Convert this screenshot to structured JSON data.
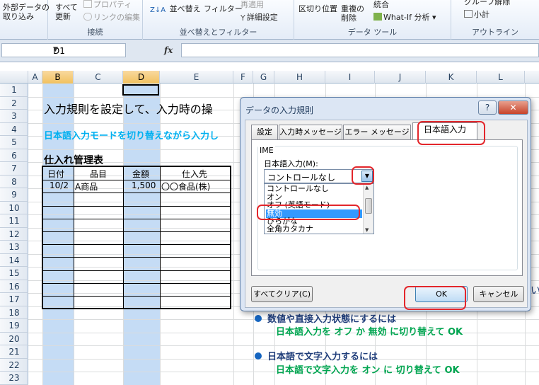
{
  "ribbon": {
    "external_data": "外部データの\n取り込み",
    "refresh_all": "すべて\n更新",
    "properties": "プロパティ",
    "edit_links": "リンクの編集",
    "connections_group": "接続",
    "sort": "並べ替え",
    "filter": "フィルター",
    "reapply": "再適用",
    "advanced": "詳細設定",
    "sort_filter_group": "並べ替えとフィルター",
    "text_to_columns": "区切り位置",
    "remove_duplicates": "重複の\n削除",
    "consolidate": "統合",
    "what_if": "What-If 分析",
    "data_tools_group": "データ ツール",
    "group": "グループ解除",
    "subtotal": "小計",
    "outline_group": "アウトライン"
  },
  "formula_bar": {
    "name_box": "D1",
    "fx": "fx",
    "formula": ""
  },
  "columns": [
    "A",
    "B",
    "C",
    "D",
    "E",
    "F",
    "G",
    "H",
    "I",
    "J",
    "K",
    "L"
  ],
  "rows": [
    "1",
    "2",
    "3",
    "4",
    "5",
    "6",
    "7",
    "8",
    "9",
    "10",
    "11",
    "12",
    "13",
    "14",
    "15",
    "16",
    "17",
    "18",
    "19",
    "20",
    "21",
    "22",
    "23"
  ],
  "sheet": {
    "title": "入力規則を設定して、入力時の操",
    "subtitle": "日本語入力モードを切り替えながら入力し",
    "table_caption": "仕入れ管理表",
    "headers": [
      "日付",
      "品目",
      "金額",
      "仕入先"
    ],
    "row1": [
      "10/2",
      "A商品",
      "1,500",
      "〇〇食品(株)"
    ]
  },
  "notes": {
    "n1_head": "数値や直接入力状態にするには",
    "n1_sub": "日本語入力を オフ か 無効 に切り替えて OK",
    "n2_head": "日本語で文字入力するには",
    "n2_sub": "日本語で文字入力を オン に 切り替えて OK",
    "side_char": "い"
  },
  "dialog": {
    "title": "データの入力規則",
    "help": "?",
    "close": "✕",
    "tabs": [
      "設定",
      "入力時メッセージ",
      "エラー メッセージ",
      "日本語入力"
    ],
    "group_label": "IME",
    "mode_label": "日本語入力(M):",
    "combo_value": "コントロールなし",
    "options": [
      "コントロールなし",
      "オン",
      "オフ (英語モード)",
      "無効",
      "ひらがな",
      "全角カタカナ"
    ],
    "selected_option": "無効",
    "clear_all": "すべてクリア(C)",
    "ok": "OK",
    "cancel": "キャンセル"
  },
  "colors": {
    "highlight_red": "#e3262b",
    "selection_blue": "#3399ff",
    "column_highlight": "#c5dcf5",
    "note_green": "#00a550"
  }
}
